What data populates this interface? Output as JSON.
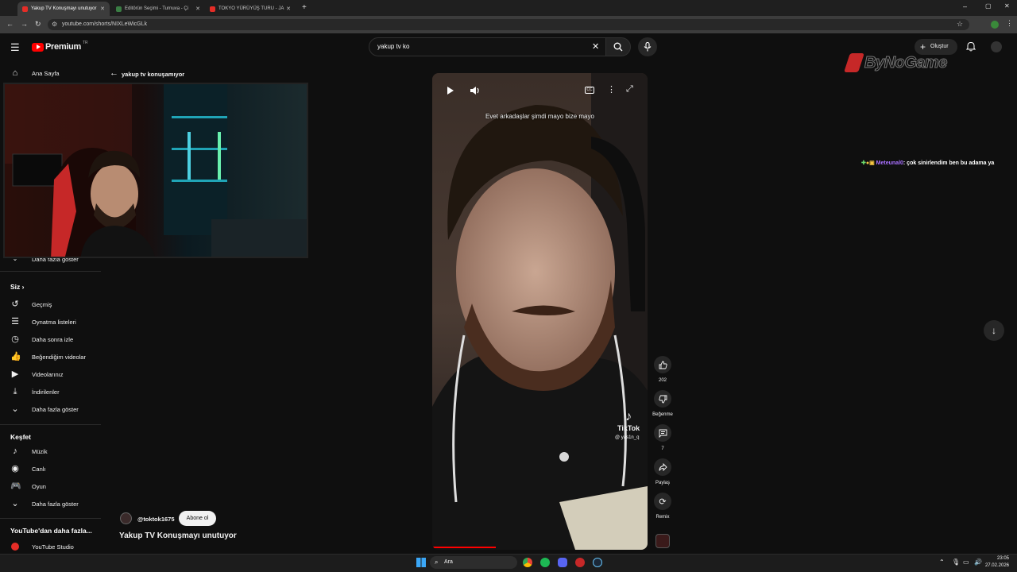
{
  "browser": {
    "tabs": [
      {
        "label": "Yakup TV Konuşmayı unutuyor",
        "color": "#e52d27"
      },
      {
        "label": "Editörün Seçimi - Turnuva - Çi",
        "color": "#3a7d44"
      },
      {
        "label": "TOKYO YÜRÜYÜŞ TURU - JA",
        "color": "#e52d27"
      }
    ],
    "url": "youtube.com/shorts/NIXLeWicGLk"
  },
  "header": {
    "logo": "Premium",
    "logo_badge": "TR",
    "search_value": "yakup tv ko",
    "create_label": "Oluştur"
  },
  "sidebar": {
    "home": "Ana Sayfa",
    "show_more_top": "Daha fazla göster",
    "you_section": "Siz",
    "you_items": [
      {
        "label": "Geçmiş",
        "icon": "history-icon"
      },
      {
        "label": "Oynatma listeleri",
        "icon": "playlist-icon"
      },
      {
        "label": "Daha sonra izle",
        "icon": "clock-icon"
      },
      {
        "label": "Beğendiğim videolar",
        "icon": "thumb-up-icon"
      },
      {
        "label": "Videolarınız",
        "icon": "video-icon"
      },
      {
        "label": "İndirilenler",
        "icon": "download-icon"
      },
      {
        "label": "Daha fazla göster",
        "icon": "chevron-down-icon"
      }
    ],
    "explore_section": "Keşfet",
    "explore_items": [
      {
        "label": "Müzik",
        "icon": "music-icon"
      },
      {
        "label": "Canlı",
        "icon": "live-icon"
      },
      {
        "label": "Oyun",
        "icon": "game-icon"
      },
      {
        "label": "Daha fazla göster",
        "icon": "chevron-down-icon"
      }
    ],
    "more_section": "YouTube'dan daha fazla...",
    "studio": "YouTube Studio"
  },
  "shorts": {
    "back_title": "yakup tv konuşamıyor",
    "caption": "Evet arkadaşlar şimdi mayo bize mayo",
    "tiktok_brand": "TikTok",
    "tiktok_user": "@ yas1n_q",
    "likes": "202",
    "dislike_label": "Beğenme",
    "comments": "7",
    "share_label": "Paylaş",
    "remix_label": "Remix",
    "channel": "@toktok1675",
    "subscribe": "Abone ol",
    "title": "Yakup TV Konuşmayı unutuyor"
  },
  "overlay": {
    "brand": "ByNoGame",
    "chat_user": "Meteunal0",
    "chat_message": ": çok sinirlendim ben bu adama ya",
    "chat_user_color": "#a970ff"
  },
  "taskbar": {
    "search": "Ara",
    "time": "23:05",
    "date": "27.02.2026"
  }
}
